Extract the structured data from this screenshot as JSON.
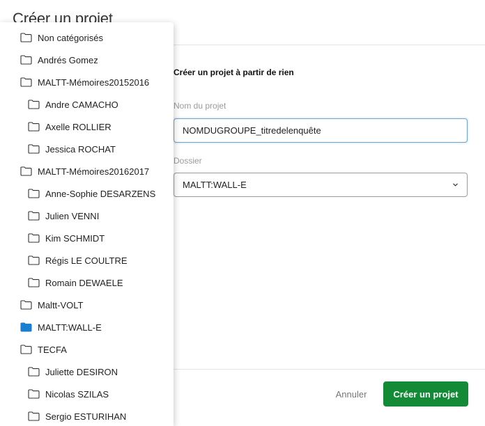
{
  "modal": {
    "title": "Créer un projet",
    "section_heading": "Créer un projet à partir de rien",
    "name_field": {
      "label": "Nom du projet",
      "value": "NOMDUGROUPE_titredelenquête"
    },
    "folder_field": {
      "label": "Dossier",
      "selected": "MALTT:WALL-E"
    },
    "buttons": {
      "cancel": "Annuler",
      "create": "Créer un projet"
    }
  },
  "folder_dropdown": {
    "items": [
      {
        "label": "Non catégorisés",
        "level": 0,
        "selected": false
      },
      {
        "label": "Andrés Gomez",
        "level": 0,
        "selected": false
      },
      {
        "label": "MALTT-Mémoires20152016",
        "level": 0,
        "selected": false
      },
      {
        "label": "Andre CAMACHO",
        "level": 1,
        "selected": false
      },
      {
        "label": "Axelle ROLLIER",
        "level": 1,
        "selected": false
      },
      {
        "label": "Jessica ROCHAT",
        "level": 1,
        "selected": false
      },
      {
        "label": "MALTT-Mémoires20162017",
        "level": 0,
        "selected": false
      },
      {
        "label": "Anne-Sophie DESARZENS",
        "level": 1,
        "selected": false
      },
      {
        "label": "Julien VENNI",
        "level": 1,
        "selected": false
      },
      {
        "label": "Kim SCHMIDT",
        "level": 1,
        "selected": false
      },
      {
        "label": "Régis LE COULTRE",
        "level": 1,
        "selected": false
      },
      {
        "label": "Romain DEWAELE",
        "level": 1,
        "selected": false
      },
      {
        "label": "Maltt-VOLT",
        "level": 0,
        "selected": false
      },
      {
        "label": "MALTT:WALL-E",
        "level": 0,
        "selected": true
      },
      {
        "label": "TECFA",
        "level": 0,
        "selected": false
      },
      {
        "label": "Juliette DESIRON",
        "level": 1,
        "selected": false
      },
      {
        "label": "Nicolas SZILAS",
        "level": 1,
        "selected": false
      },
      {
        "label": "Sergio ESTURIHAN",
        "level": 1,
        "selected": false
      }
    ]
  },
  "icons": {
    "folder": "folder-icon",
    "folder_selected": "folder-filled-icon",
    "chevron": "chevron-down-icon"
  },
  "colors": {
    "primary_button": "#138a36",
    "folder_selected": "#1a7fd1",
    "input_focus_border": "#6d9fd1",
    "label_gray": "#9a9a9a"
  }
}
